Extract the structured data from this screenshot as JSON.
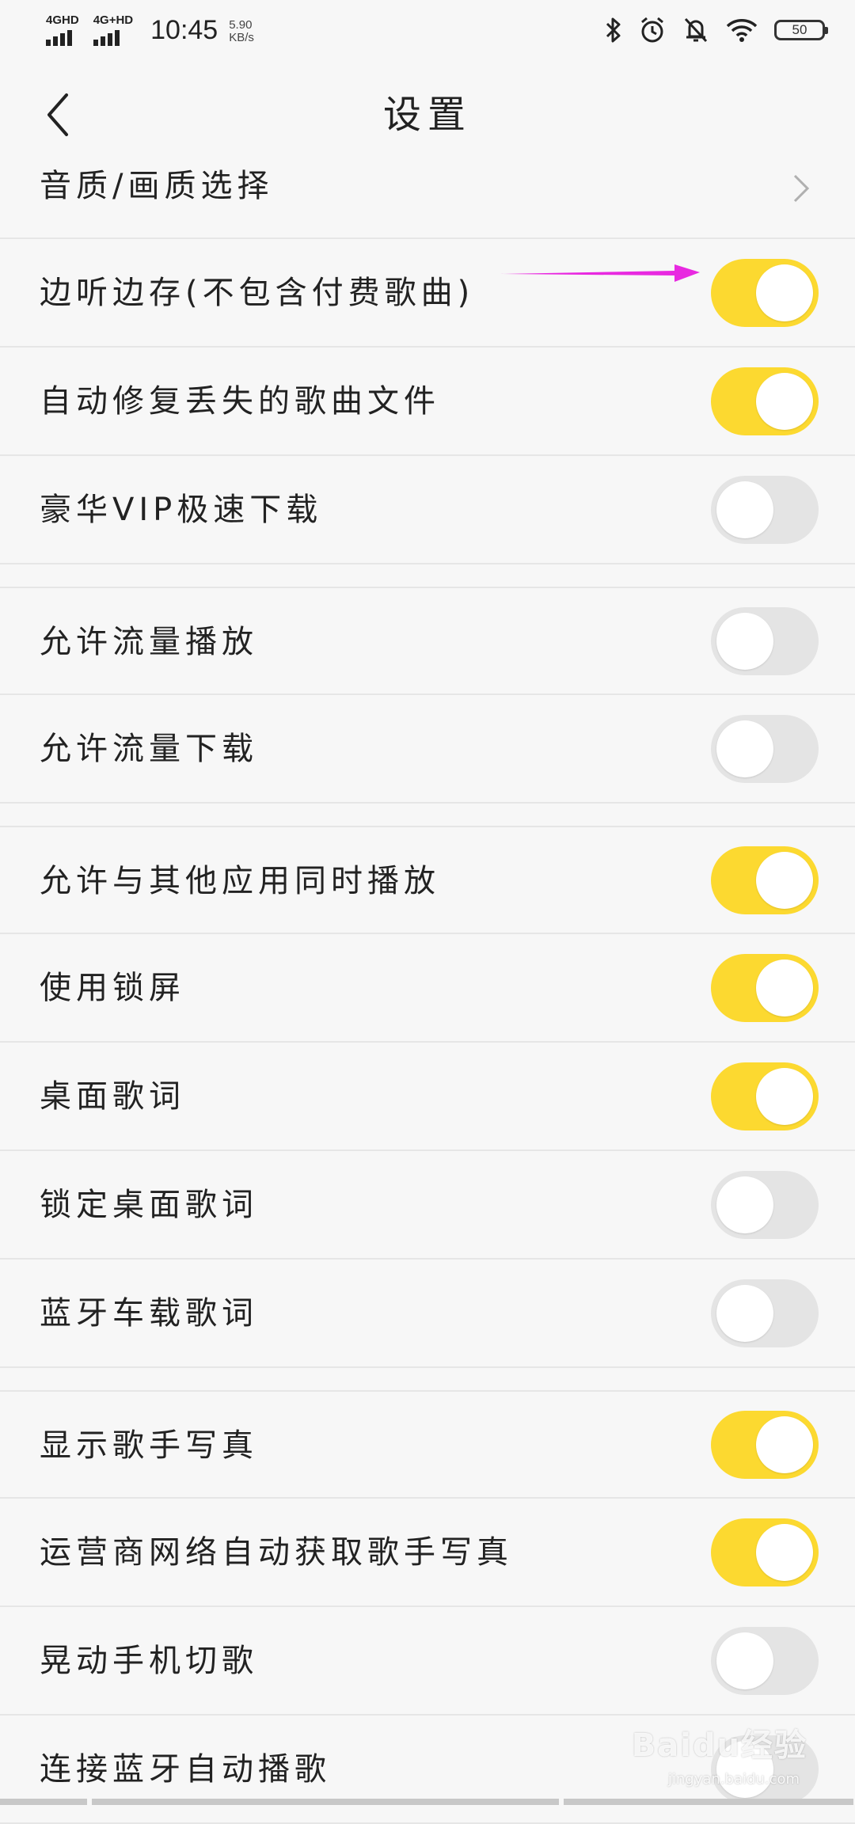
{
  "status_bar": {
    "net1": "4GHD",
    "net2": "4G+HD",
    "time": "10:45",
    "speed_value": "5.90",
    "speed_unit": "KB/s",
    "battery": "50"
  },
  "header": {
    "title": "设置"
  },
  "rows": [
    {
      "label": "音质/画质选择",
      "type": "nav"
    },
    {
      "label": "边听边存(不包含付费歌曲)",
      "on": true
    },
    {
      "label": "自动修复丢失的歌曲文件",
      "on": true
    },
    {
      "label": "豪华VIP极速下载",
      "on": false
    },
    {
      "label": "允许流量播放",
      "on": false
    },
    {
      "label": "允许流量下载",
      "on": false
    },
    {
      "label": "允许与其他应用同时播放",
      "on": true
    },
    {
      "label": "使用锁屏",
      "on": true
    },
    {
      "label": "桌面歌词",
      "on": true
    },
    {
      "label": "锁定桌面歌词",
      "on": false
    },
    {
      "label": "蓝牙车载歌词",
      "on": false
    },
    {
      "label": "显示歌手写真",
      "on": true
    },
    {
      "label": "运营商网络自动获取歌手写真",
      "on": true
    },
    {
      "label": "晃动手机切歌",
      "on": false
    },
    {
      "label": "连接蓝牙自动播歌",
      "on": false
    }
  ],
  "colors": {
    "toggle_on": "#fcd930",
    "toggle_off": "#e4e4e4",
    "annotation_arrow": "#e829e0"
  },
  "watermark": {
    "text": "Baidu经验",
    "url": "jingyan.baidu.com"
  }
}
